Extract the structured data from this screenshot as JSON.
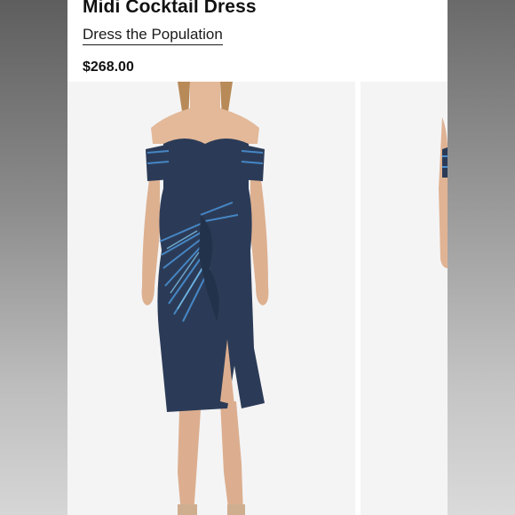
{
  "product": {
    "title": "Midi Cocktail Dress",
    "brand": "Dress the Population",
    "price": "$268.00"
  },
  "gallery": {
    "images": [
      {
        "description_icon": "dress-photo-front"
      },
      {
        "description_icon": "dress-photo-partial"
      }
    ]
  },
  "colors": {
    "dress": "#2b3b57",
    "background": "#f4f4f5",
    "sequin": "#3f7fbf"
  }
}
